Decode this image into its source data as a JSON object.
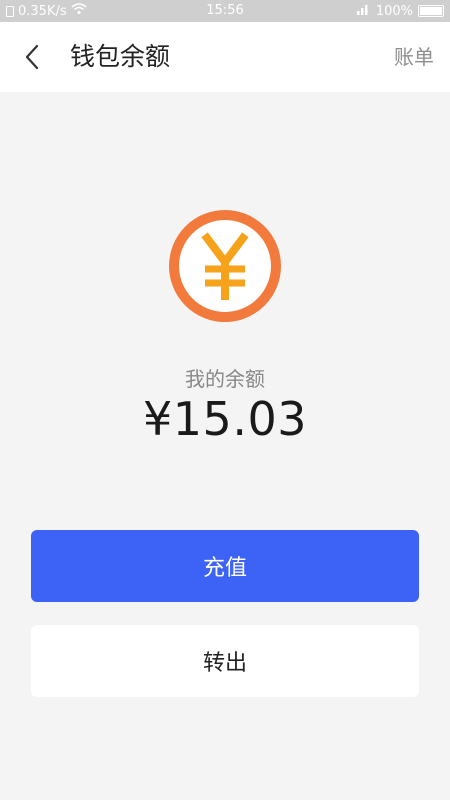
{
  "status_bar": {
    "network_speed": "0.35K/s",
    "time": "15:56",
    "battery_percent": "100%",
    "icons": [
      "sim-icon",
      "wifi-icon",
      "signal-icon",
      "battery-icon"
    ]
  },
  "header": {
    "back_icon": "chevron-left-icon",
    "title": "钱包余额",
    "action_label": "账单"
  },
  "balance": {
    "coin_icon": "yuan-coin-icon",
    "label": "我的余额",
    "amount": "¥15.03"
  },
  "actions": {
    "recharge_label": "充值",
    "withdraw_label": "转出"
  },
  "colors": {
    "accent": "#3d63f6",
    "coin_ring": "#f27a3c",
    "coin_symbol": "#f7a21b",
    "background": "#f4f4f4"
  }
}
